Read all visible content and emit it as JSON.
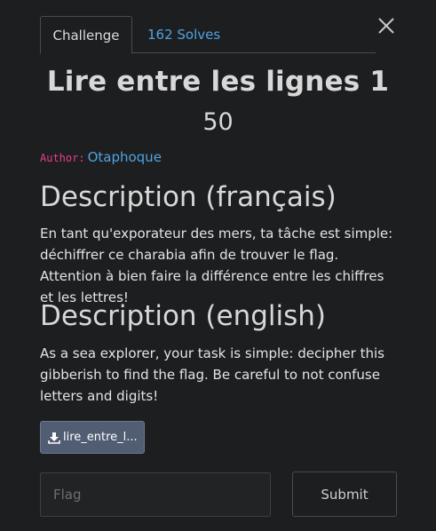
{
  "tabs": {
    "challenge": "Challenge",
    "solves": "162 Solves"
  },
  "challenge": {
    "title": "Lire entre les lignes 1",
    "value": "50",
    "author_key": "Author:",
    "author_name": "Otaphoque"
  },
  "description_fr": {
    "heading": "Description (français)",
    "text": "En tant qu'exporateur des mers, ta tâche est simple: déchiffrer ce charabia afin de trouver le flag. Attention à bien faire la différence entre les chiffres et les lettres!"
  },
  "description_en": {
    "heading": "Description (english)",
    "text": "As a sea explorer, your task is simple: decipher this gibberish to find the flag. Be careful to not confuse letters and digits!"
  },
  "file": {
    "label": "lire_entre_l...",
    "icon": "download-icon"
  },
  "form": {
    "flag_placeholder": "Flag",
    "flag_value": "",
    "submit_label": "Submit"
  },
  "icons": {
    "close": "close-icon"
  },
  "colors": {
    "background": "#1d1e20",
    "link": "#4fa3e0",
    "author_key": "#e83e8c",
    "file_button": "#515d72"
  }
}
